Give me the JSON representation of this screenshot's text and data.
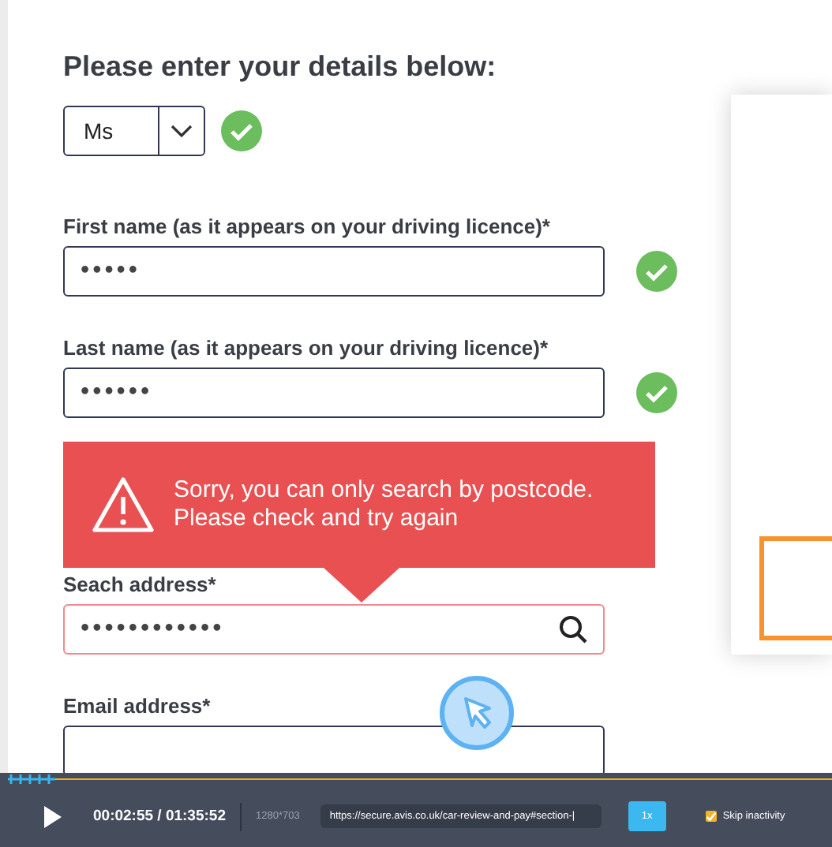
{
  "form": {
    "heading": "Please enter your details below:",
    "title_select": {
      "value": "Ms",
      "valid": true
    },
    "fields": [
      {
        "label": "First name (as it appears on your driving licence)*",
        "value": "•••••",
        "valid": true,
        "error": false,
        "kind": "text"
      },
      {
        "label": "Last name (as it appears on your driving licence)*",
        "value": "••••••",
        "valid": true,
        "error": false,
        "kind": "text"
      },
      {
        "label": "Seach address*",
        "value": "••••••••••••",
        "valid": false,
        "error": true,
        "kind": "search"
      },
      {
        "label": "Email address*",
        "valid": false,
        "error": false,
        "kind": "text"
      }
    ],
    "error_tooltip": {
      "lines": [
        "Sorry, you can only search by postcode.",
        "Please check and try again"
      ]
    }
  },
  "player": {
    "time": "00:02:55 / 01:35:52",
    "resolution": "1280*703",
    "url": "https://secure.avis.co.uk/car-review-and-pay#section-|",
    "speed": "1x",
    "skip_inactivity": {
      "label": "Skip inactivity",
      "checked": true
    }
  }
}
